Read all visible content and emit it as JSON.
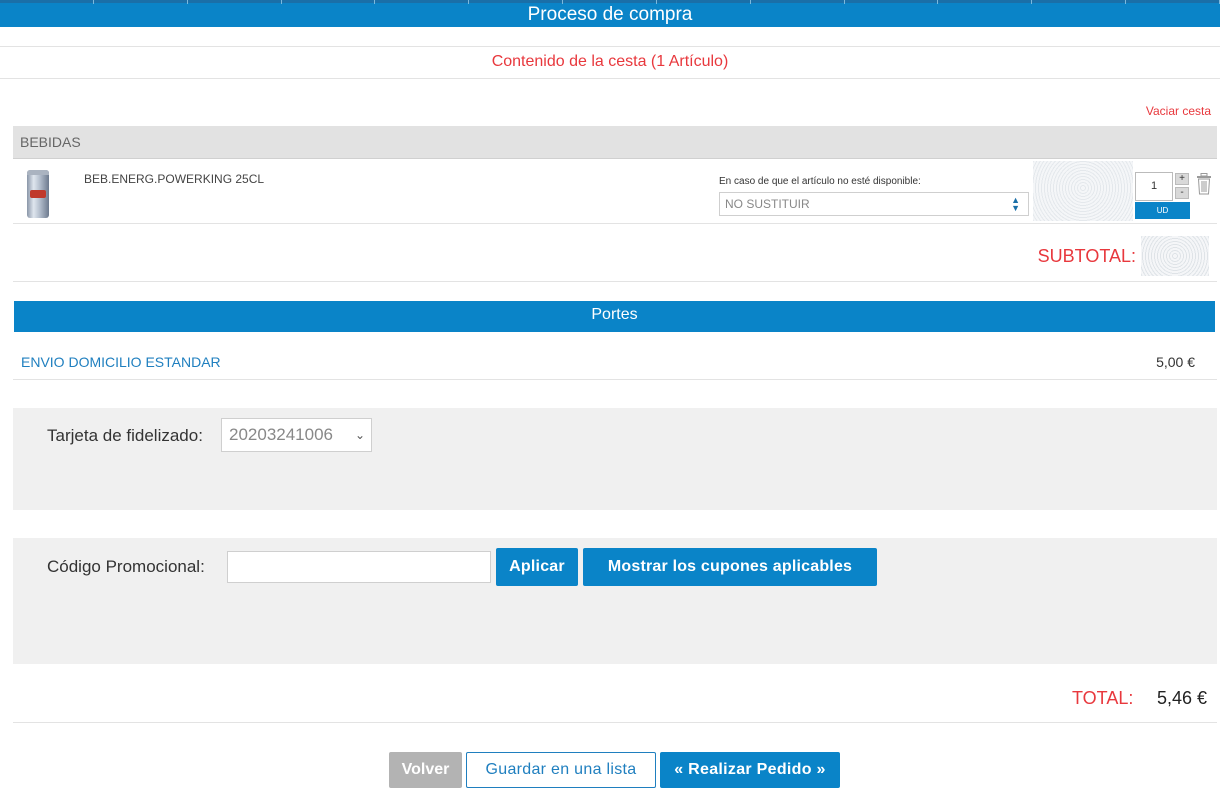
{
  "header": {
    "title": "Proceso de compra"
  },
  "cart": {
    "title": "Contenido de la cesta (1 Artículo)",
    "empty_link": "Vaciar cesta",
    "category": "BEBIDAS",
    "items": [
      {
        "name": "BEB.ENERG.POWERKING 25CL",
        "substitution_label": "En caso de que el artículo no esté disponible:",
        "substitution_value": "NO SUSTITUIR",
        "quantity": "1",
        "unit": "UD",
        "plus": "+",
        "minus": "-"
      }
    ],
    "subtotal_label": "SUBTOTAL:"
  },
  "shipping": {
    "title": "Portes",
    "method": "ENVIO DOMICILIO ESTANDAR",
    "price": "5,00 €"
  },
  "loyalty": {
    "label": "Tarjeta de fidelizado:",
    "value": "20203241006"
  },
  "promo": {
    "label": "Código Promocional:",
    "input_value": "",
    "apply_label": "Aplicar",
    "coupons_label": "Mostrar los cupones aplicables"
  },
  "totals": {
    "label": "TOTAL:",
    "value": "5,46 €"
  },
  "actions": {
    "back_label": "Volver",
    "save_label": "Guardar en una lista",
    "order_label": "« Realizar Pedido »"
  },
  "colors": {
    "primary": "#0a84c8",
    "accent_red": "#e8383d",
    "panel_gray": "#f0f0f0",
    "disabled_gray": "#b3b3b3"
  },
  "icons": {
    "trash": "trash-icon",
    "select_arrows": "up-down-arrows-icon",
    "chevron": "chevron-down-icon"
  }
}
